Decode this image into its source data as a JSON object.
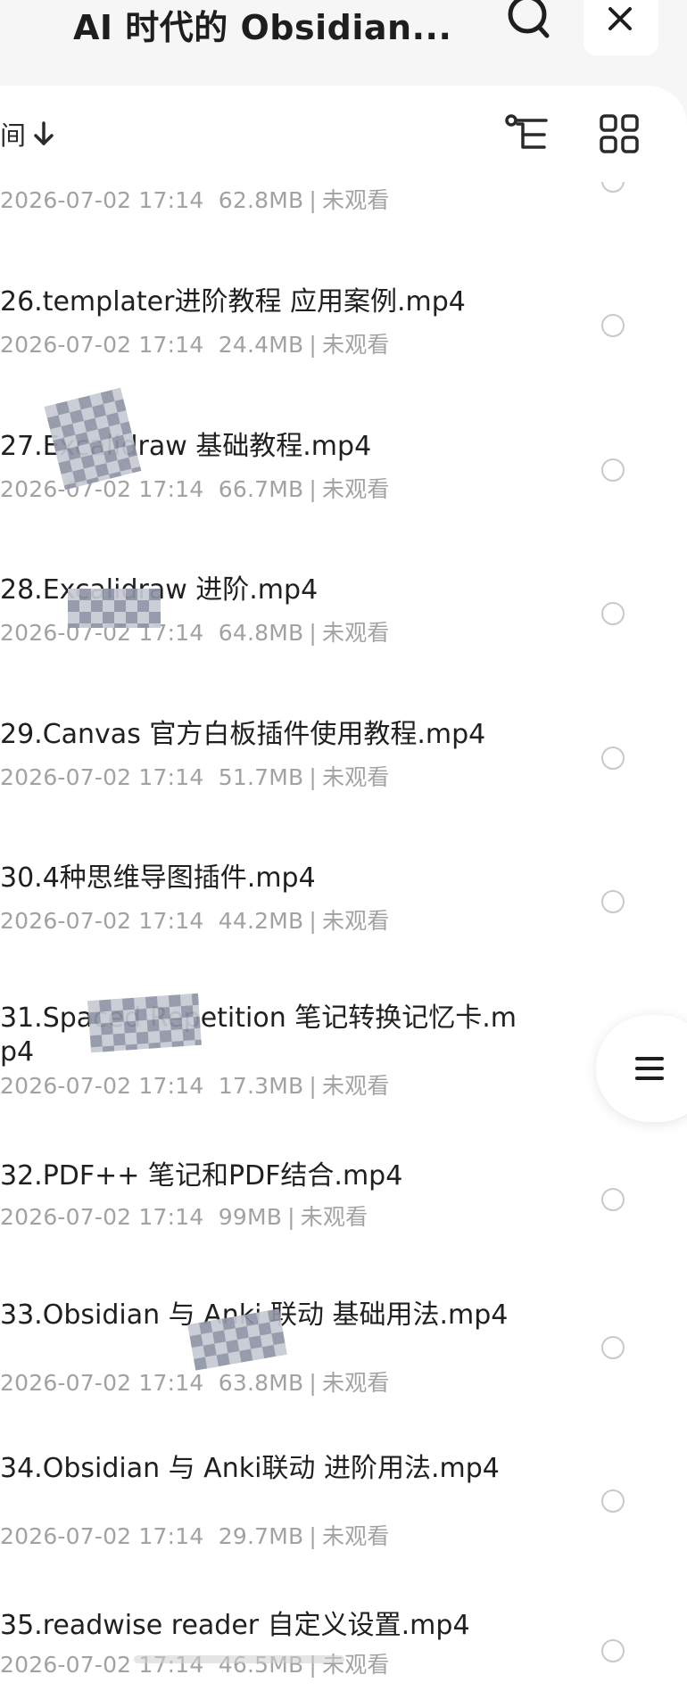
{
  "header": {
    "title": "AI 时代的 Obsidian...",
    "search_icon": "search-icon",
    "close_icon": "close-icon"
  },
  "toolbar": {
    "sort_label": "间",
    "sort_icon": "arrow-down-icon",
    "tree_icon": "tree-view-icon",
    "grid_icon": "grid-view-icon"
  },
  "files": [
    {
      "name": "",
      "date": "2026-07-02 17:14",
      "size": "62.8MB",
      "status": "未观看"
    },
    {
      "name": "26.templater进阶教程 应用案例.mp4",
      "date": "2026-07-02 17:14",
      "size": "24.4MB",
      "status": "未观看"
    },
    {
      "name": "27.Excalidraw 基础教程.mp4",
      "date": "2026-07-02 17:14",
      "size": "66.7MB",
      "status": "未观看"
    },
    {
      "name": "28.Excalidraw 进阶.mp4",
      "date": "2026-07-02 17:14",
      "size": "64.8MB",
      "status": "未观看"
    },
    {
      "name": "29.Canvas 官方白板插件使用教程.mp4",
      "date": "2026-07-02 17:14",
      "size": "51.7MB",
      "status": "未观看"
    },
    {
      "name": "30.4种思维导图插件.mp4",
      "date": "2026-07-02 17:14",
      "size": "44.2MB",
      "status": "未观看"
    },
    {
      "name": "31.Spaced Repetition 笔记转换记忆卡.mp4",
      "date": "2026-07-02 17:14",
      "size": "17.3MB",
      "status": "未观看"
    },
    {
      "name": "32.PDF++ 笔记和PDF结合.mp4",
      "date": "2026-07-02 17:14",
      "size": "99MB",
      "status": "未观看"
    },
    {
      "name": "33.Obsidian 与 Anki 联动  基础用法.mp4",
      "date": "2026-07-02 17:14",
      "size": "63.8MB",
      "status": "未观看"
    },
    {
      "name": "34.Obsidian 与 Anki联动  进阶用法.mp4",
      "date": "2026-07-02 17:14",
      "size": "29.7MB",
      "status": "未观看"
    },
    {
      "name": "35.readwise reader 自定义设置.mp4",
      "date": "2026-07-02 17:14",
      "size": "46.5MB",
      "status": "未观看"
    }
  ],
  "float_menu": {
    "icon": "menu-icon"
  },
  "colors": {
    "background": "#f6f6f6",
    "sheet": "#ffffff",
    "primary_text": "#202020",
    "secondary_text": "#a2a2a2",
    "radio_border": "#c9c9c9"
  }
}
